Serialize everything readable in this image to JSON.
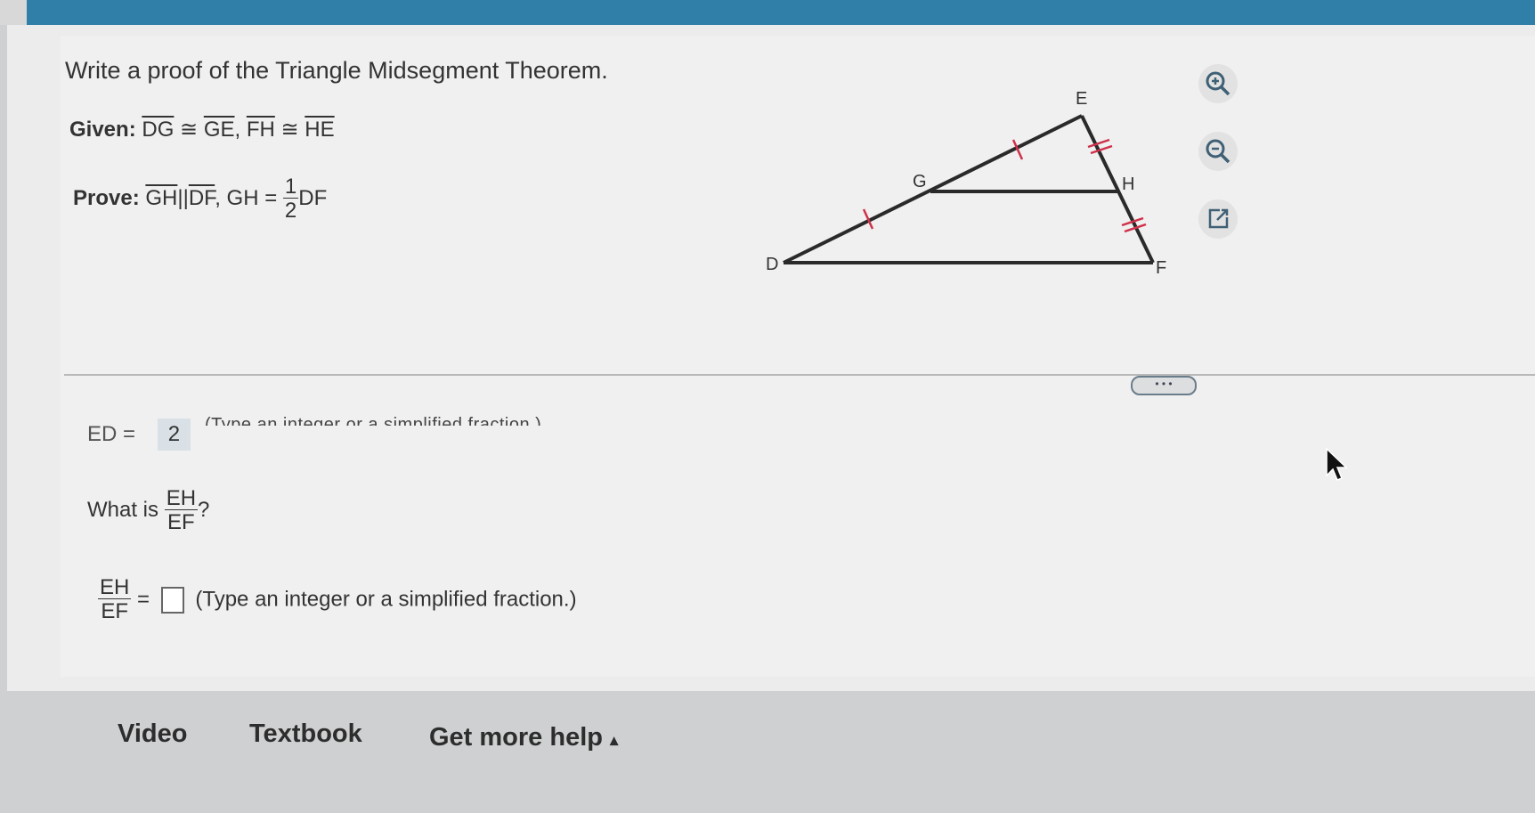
{
  "problem": {
    "headline": "Write a proof of the Triangle Midsegment Theorem.",
    "given_label": "Given:",
    "given_seg1": "DG",
    "congruent": "≅",
    "given_seg2": "GE",
    "given_sep": ",",
    "given_seg3": "FH",
    "given_seg4": "HE",
    "prove_label": "Prove:",
    "prove_seg1": "GH",
    "parallel": "||",
    "prove_seg2": "DF",
    "prove_rest_a": ", GH =",
    "prove_num": "1",
    "prove_den": "2",
    "prove_rest_b": "DF"
  },
  "figure": {
    "labels": {
      "E": "E",
      "G": "G",
      "H": "H",
      "D": "D",
      "F": "F"
    }
  },
  "tools": {
    "zoom_in": "zoom-in-icon",
    "zoom_out": "zoom-out-icon",
    "popout": "popout-icon"
  },
  "previous": {
    "prefix": "ED",
    "equals": "=",
    "answer": "2",
    "hint": "(Type an integer or a simplified fraction.)",
    "more": "• • •"
  },
  "question": {
    "prefix": "What is",
    "num": "EH",
    "den": "EF",
    "suffix": "?"
  },
  "answer": {
    "num": "EH",
    "den": "EF",
    "equals": "=",
    "value": "",
    "hint": "(Type an integer or a simplified fraction.)"
  },
  "footer": {
    "video": "Video",
    "textbook": "Textbook",
    "help": "Get more help",
    "help_arrow": "▴"
  }
}
